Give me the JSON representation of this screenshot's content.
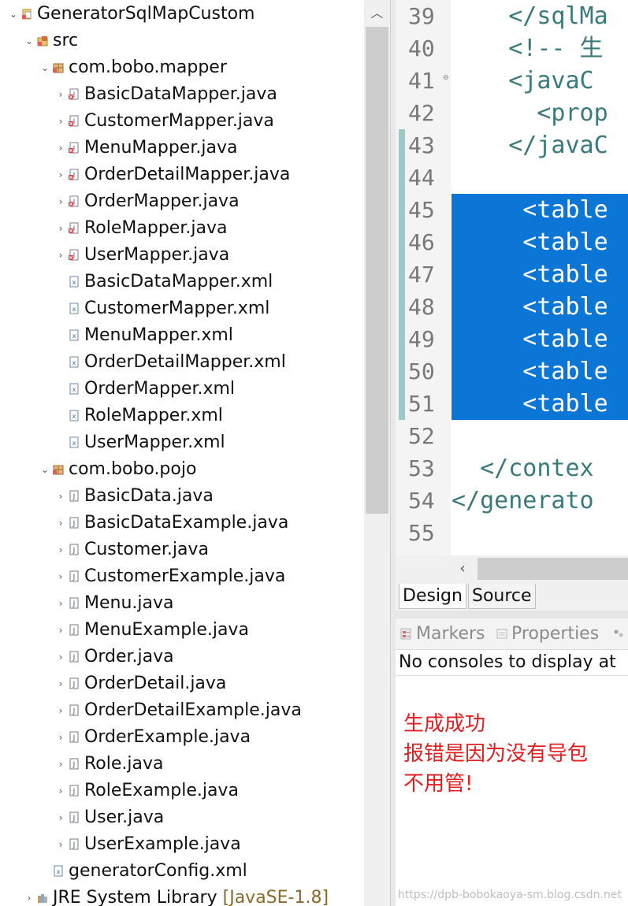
{
  "colors": {
    "selection": "#0b76d6",
    "xml_tag": "#3a7a7a",
    "line_number": "#787878",
    "annotation": "#e02020",
    "change_bar": "#9cc8c8"
  },
  "tree": {
    "items": [
      {
        "label": "GeneratorSqlMapCustom",
        "level": 0,
        "twisty": "expanded",
        "icon": "project-icon"
      },
      {
        "label": "src",
        "level": 1,
        "twisty": "expanded",
        "icon": "source-folder-icon"
      },
      {
        "label": "com.bobo.mapper",
        "level": 2,
        "twisty": "expanded",
        "icon": "package-icon"
      },
      {
        "label": "BasicDataMapper.java",
        "level": 3,
        "twisty": "collapsed",
        "icon": "java-interface-error-icon"
      },
      {
        "label": "CustomerMapper.java",
        "level": 3,
        "twisty": "collapsed",
        "icon": "java-interface-error-icon"
      },
      {
        "label": "MenuMapper.java",
        "level": 3,
        "twisty": "collapsed",
        "icon": "java-interface-error-icon"
      },
      {
        "label": "OrderDetailMapper.java",
        "level": 3,
        "twisty": "collapsed",
        "icon": "java-interface-error-icon"
      },
      {
        "label": "OrderMapper.java",
        "level": 3,
        "twisty": "collapsed",
        "icon": "java-interface-error-icon"
      },
      {
        "label": "RoleMapper.java",
        "level": 3,
        "twisty": "collapsed",
        "icon": "java-interface-error-icon"
      },
      {
        "label": "UserMapper.java",
        "level": 3,
        "twisty": "collapsed",
        "icon": "java-interface-error-icon"
      },
      {
        "label": "BasicDataMapper.xml",
        "level": 3,
        "twisty": "none",
        "icon": "xml-file-icon"
      },
      {
        "label": "CustomerMapper.xml",
        "level": 3,
        "twisty": "none",
        "icon": "xml-file-icon"
      },
      {
        "label": "MenuMapper.xml",
        "level": 3,
        "twisty": "none",
        "icon": "xml-file-icon"
      },
      {
        "label": "OrderDetailMapper.xml",
        "level": 3,
        "twisty": "none",
        "icon": "xml-file-icon"
      },
      {
        "label": "OrderMapper.xml",
        "level": 3,
        "twisty": "none",
        "icon": "xml-file-icon"
      },
      {
        "label": "RoleMapper.xml",
        "level": 3,
        "twisty": "none",
        "icon": "xml-file-icon"
      },
      {
        "label": "UserMapper.xml",
        "level": 3,
        "twisty": "none",
        "icon": "xml-file-icon"
      },
      {
        "label": "com.bobo.pojo",
        "level": 2,
        "twisty": "expanded",
        "icon": "package-icon"
      },
      {
        "label": "BasicData.java",
        "level": 3,
        "twisty": "collapsed",
        "icon": "java-file-icon"
      },
      {
        "label": "BasicDataExample.java",
        "level": 3,
        "twisty": "collapsed",
        "icon": "java-file-icon"
      },
      {
        "label": "Customer.java",
        "level": 3,
        "twisty": "collapsed",
        "icon": "java-file-icon"
      },
      {
        "label": "CustomerExample.java",
        "level": 3,
        "twisty": "collapsed",
        "icon": "java-file-icon"
      },
      {
        "label": "Menu.java",
        "level": 3,
        "twisty": "collapsed",
        "icon": "java-file-icon"
      },
      {
        "label": "MenuExample.java",
        "level": 3,
        "twisty": "collapsed",
        "icon": "java-file-icon"
      },
      {
        "label": "Order.java",
        "level": 3,
        "twisty": "collapsed",
        "icon": "java-file-icon"
      },
      {
        "label": "OrderDetail.java",
        "level": 3,
        "twisty": "collapsed",
        "icon": "java-file-icon"
      },
      {
        "label": "OrderDetailExample.java",
        "level": 3,
        "twisty": "collapsed",
        "icon": "java-file-icon"
      },
      {
        "label": "OrderExample.java",
        "level": 3,
        "twisty": "collapsed",
        "icon": "java-file-icon"
      },
      {
        "label": "Role.java",
        "level": 3,
        "twisty": "collapsed",
        "icon": "java-file-icon"
      },
      {
        "label": "RoleExample.java",
        "level": 3,
        "twisty": "collapsed",
        "icon": "java-file-icon"
      },
      {
        "label": "User.java",
        "level": 3,
        "twisty": "collapsed",
        "icon": "java-file-icon"
      },
      {
        "label": "UserExample.java",
        "level": 3,
        "twisty": "collapsed",
        "icon": "java-file-icon"
      },
      {
        "label": "generatorConfig.xml",
        "level": 2,
        "twisty": "none",
        "icon": "xml-file-icon"
      },
      {
        "label": "JRE System Library",
        "decoration": " [JavaSE-1.8]",
        "level": 1,
        "twisty": "collapsed",
        "icon": "library-icon"
      }
    ]
  },
  "editor": {
    "lines": [
      {
        "num": "39",
        "code": "    </sqlMa",
        "selected": false,
        "changed": false,
        "fold": false
      },
      {
        "num": "40",
        "code": "    <!-- 生",
        "selected": false,
        "changed": false,
        "fold": false
      },
      {
        "num": "41",
        "code": "    <javaC",
        "selected": false,
        "changed": false,
        "fold": true
      },
      {
        "num": "42",
        "code": "      <prop",
        "selected": false,
        "changed": false,
        "fold": false
      },
      {
        "num": "43",
        "code": "    </javaC",
        "selected": false,
        "changed": true,
        "fold": false
      },
      {
        "num": "44",
        "code": "",
        "selected": false,
        "changed": true,
        "fold": false
      },
      {
        "num": "45",
        "code": "     <table",
        "selected": true,
        "changed": true,
        "fold": false
      },
      {
        "num": "46",
        "code": "     <table",
        "selected": true,
        "changed": true,
        "fold": false
      },
      {
        "num": "47",
        "code": "     <table",
        "selected": true,
        "changed": true,
        "fold": false
      },
      {
        "num": "48",
        "code": "     <table",
        "selected": true,
        "changed": true,
        "fold": false
      },
      {
        "num": "49",
        "code": "     <table",
        "selected": true,
        "changed": true,
        "fold": false
      },
      {
        "num": "50",
        "code": "     <table",
        "selected": true,
        "changed": true,
        "fold": false
      },
      {
        "num": "51",
        "code": "     <table",
        "selected": true,
        "changed": true,
        "fold": false
      },
      {
        "num": "52",
        "code": "",
        "selected": false,
        "changed": false,
        "fold": false
      },
      {
        "num": "53",
        "code": "  </contex",
        "selected": false,
        "changed": false,
        "fold": false
      },
      {
        "num": "54",
        "code": "</generato",
        "selected": false,
        "changed": false,
        "fold": false
      },
      {
        "num": "55",
        "code": "",
        "selected": false,
        "changed": false,
        "fold": false
      }
    ],
    "tabs": {
      "design": "Design",
      "source": "Source"
    }
  },
  "views": {
    "markers": "Markers",
    "properties": "Properties"
  },
  "console": {
    "message": "No consoles to display at",
    "notes": [
      "生成成功",
      "报错是因为没有导包",
      "不用管!"
    ],
    "watermark": "https://dpb-bobokaoya-sm.blog.csdn.net"
  }
}
